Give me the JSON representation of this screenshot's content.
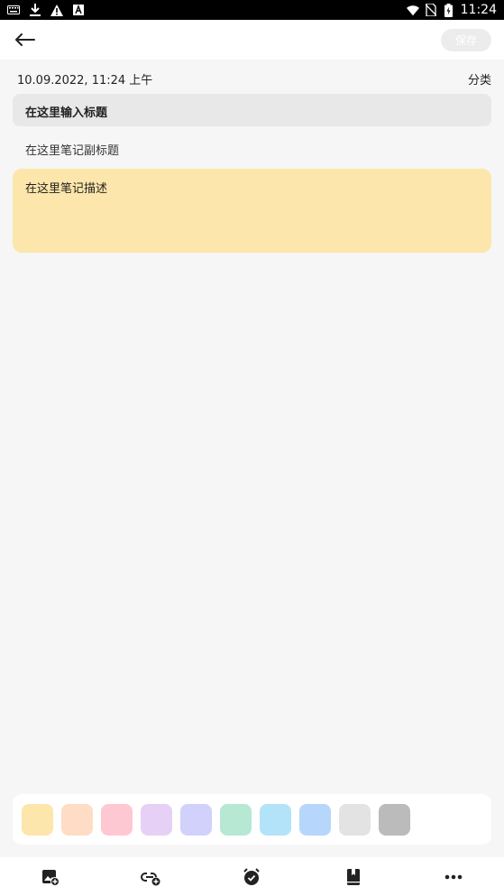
{
  "status_bar": {
    "time": "11:24",
    "left_icons": [
      "keyboard-icon",
      "download-icon",
      "warning-icon",
      "font-a-icon"
    ],
    "right_icons": [
      "wifi-icon",
      "no-sim-icon",
      "battery-charging-icon"
    ]
  },
  "toolbar": {
    "back_icon": "arrow-left-icon",
    "save_label": "保存"
  },
  "note": {
    "date": "10.09.2022, 11:24 上午",
    "category_label": "分类",
    "title_placeholder": "在这里输入标题",
    "subtitle_placeholder": "在这里笔记副标题",
    "description_placeholder": "在这里笔记描述"
  },
  "palette": {
    "colors": [
      "#fde6ab",
      "#fedcc6",
      "#fec8d3",
      "#e7d0f6",
      "#d1d1fb",
      "#b6e8d4",
      "#b3e3f8",
      "#b6d6fb",
      "#e3e3e3",
      "#bbbbbb"
    ]
  },
  "bottom_bar": {
    "items": [
      "add-image-icon",
      "add-link-icon",
      "alarm-icon",
      "notebook-icon",
      "more-icon"
    ]
  }
}
